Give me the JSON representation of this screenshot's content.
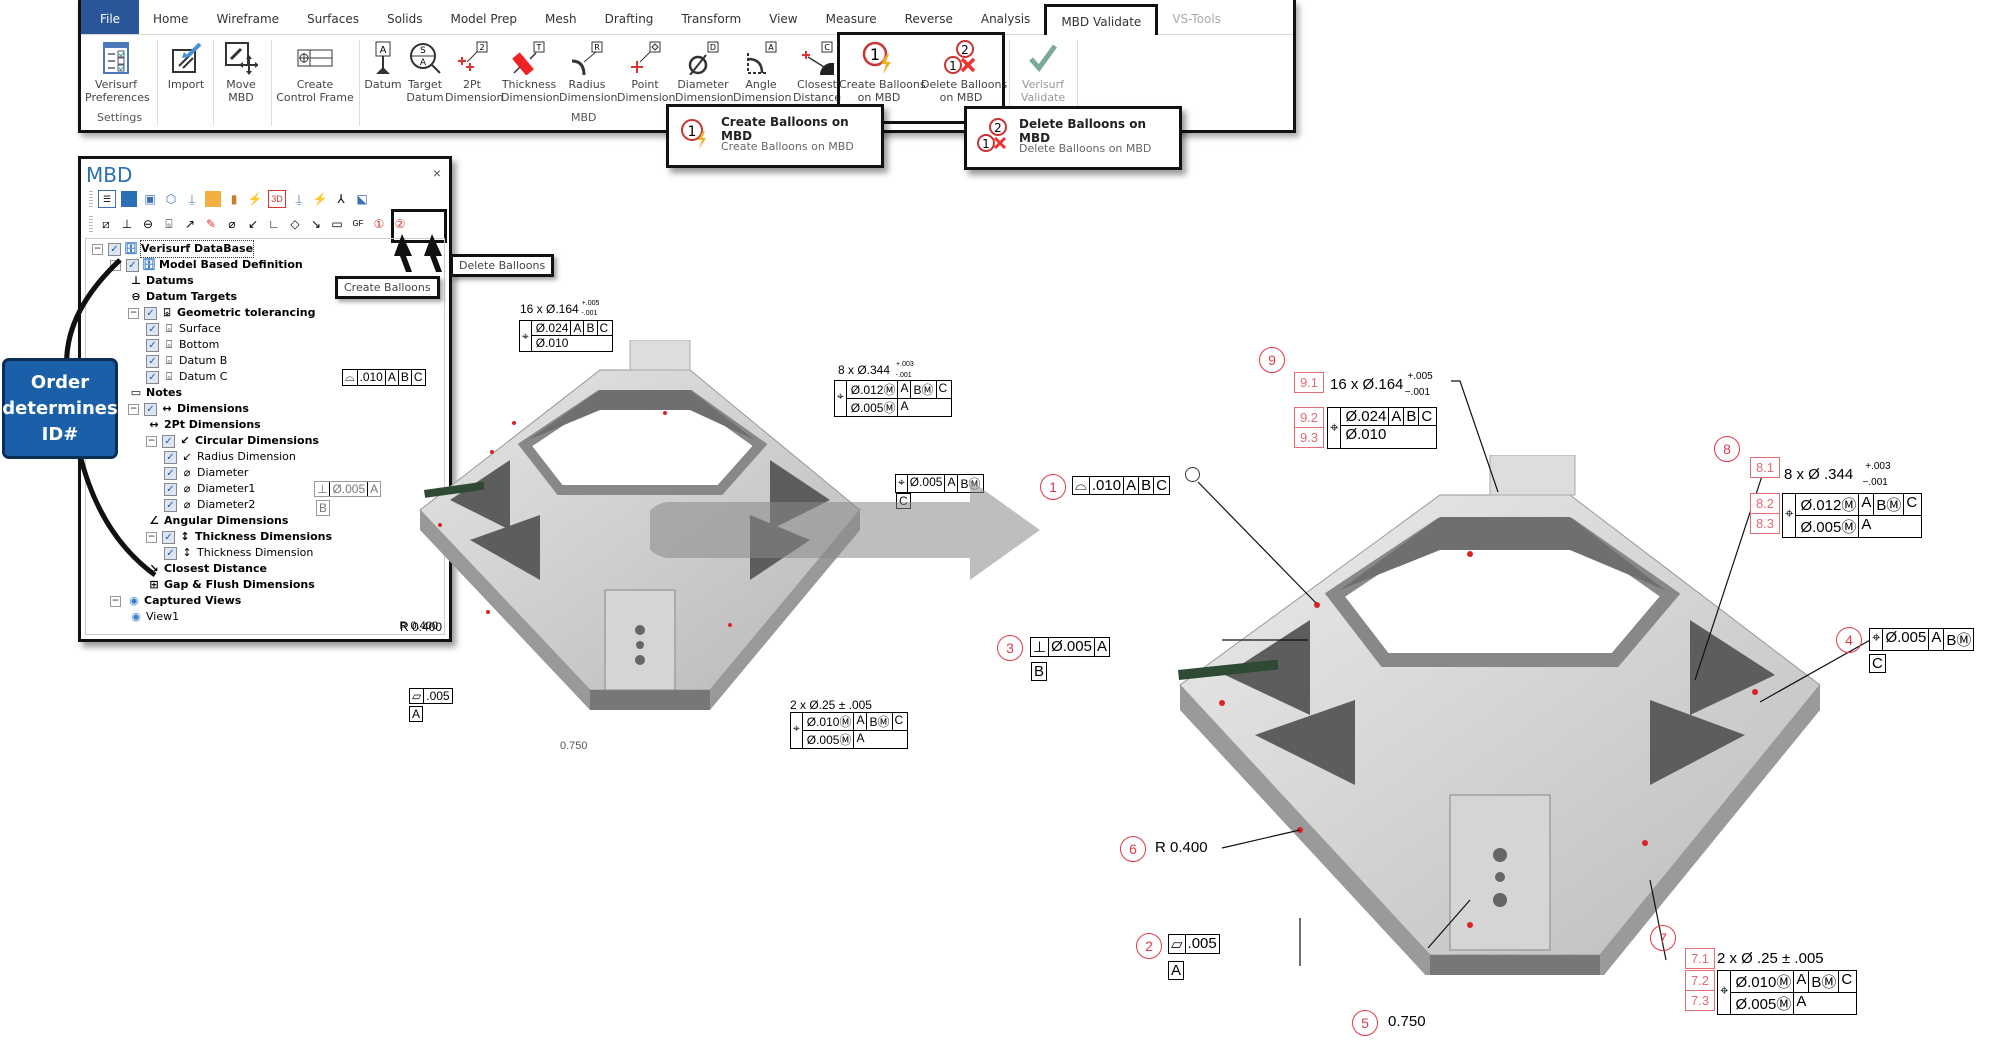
{
  "ribbon": {
    "tabs": [
      {
        "label": "File",
        "state": "file"
      },
      {
        "label": "Home"
      },
      {
        "label": "Wireframe"
      },
      {
        "label": "Surfaces"
      },
      {
        "label": "Solids"
      },
      {
        "label": "Model Prep"
      },
      {
        "label": "Mesh"
      },
      {
        "label": "Drafting"
      },
      {
        "label": "Transform"
      },
      {
        "label": "View"
      },
      {
        "label": "Measure"
      },
      {
        "label": "Reverse"
      },
      {
        "label": "Analysis"
      },
      {
        "label": "MBD Validate",
        "state": "active"
      },
      {
        "label": "VS-Tools",
        "state": "disabled"
      }
    ],
    "buttons": {
      "preferences": "Verisurf\nPreferences",
      "import": "Import",
      "move_mbd": "Move\nMBD",
      "control_frame": "Create\nControl Frame",
      "datum": "Datum",
      "target_datum": "Target\nDatum",
      "twopt": "2Pt\nDimension",
      "thickness": "Thickness\nDimension",
      "radius": "Radius\nDimension",
      "point": "Point\nDimension",
      "diameter": "Diameter\nDimension",
      "angle": "Angle\nDimension",
      "closest": "Closest\nDistance",
      "create_balloons": "Create Balloons\non MBD",
      "delete_balloons": "Delete Balloons\non MBD",
      "validate": "Verisurf\nValidate"
    },
    "groups": {
      "settings": "Settings",
      "mbd": "MBD"
    }
  },
  "tooltips": {
    "create": {
      "title": "Create Balloons on MBD",
      "desc": "Create Balloons on MBD"
    },
    "delete": {
      "title": "Delete Balloons on MBD",
      "desc": "Delete Balloons on MBD"
    },
    "create_small": "Create Balloons",
    "delete_small": "Delete Balloons"
  },
  "panel": {
    "title": "MBD",
    "close": "×",
    "tree": [
      {
        "label": "Verisurf DataBase",
        "level": 0,
        "bold": true,
        "pm": "−",
        "cb": true,
        "icon": "db"
      },
      {
        "label": "Model Based Definition",
        "level": 1,
        "bold": true,
        "pm": "−",
        "cb": true,
        "icon": "db"
      },
      {
        "label": "Datums",
        "level": 2,
        "bold": true,
        "icon": "datum"
      },
      {
        "label": "Datum Targets",
        "level": 2,
        "bold": true,
        "icon": "target"
      },
      {
        "label": "Geometric tolerancing",
        "level": 2,
        "bold": true,
        "pm": "−",
        "cb": true,
        "icon": "gt"
      },
      {
        "label": "Surface",
        "level": 3,
        "cb": true,
        "icon": "gt"
      },
      {
        "label": "Bottom",
        "level": 3,
        "cb": true,
        "icon": "gt"
      },
      {
        "label": "Datum B",
        "level": 3,
        "cb": true,
        "icon": "gt"
      },
      {
        "label": "Datum C",
        "level": 3,
        "cb": true,
        "icon": "gt"
      },
      {
        "label": "Notes",
        "level": 2,
        "bold": true,
        "icon": "note"
      },
      {
        "label": "Dimensions",
        "level": 2,
        "bold": true,
        "pm": "−",
        "cb": true,
        "icon": "dim"
      },
      {
        "label": "2Pt Dimensions",
        "level": 3,
        "bold": true,
        "icon": "dim"
      },
      {
        "label": "Circular Dimensions",
        "level": 3,
        "bold": true,
        "pm": "−",
        "cb": true,
        "icon": "rad"
      },
      {
        "label": "Radius Dimension",
        "level": 4,
        "cb": true,
        "icon": "rad"
      },
      {
        "label": "Diameter",
        "level": 4,
        "cb": true,
        "icon": "dia"
      },
      {
        "label": "Diameter1",
        "level": 4,
        "cb": true,
        "icon": "dia"
      },
      {
        "label": "Diameter2",
        "level": 4,
        "cb": true,
        "icon": "dia"
      },
      {
        "label": "Angular Dimensions",
        "level": 3,
        "bold": true,
        "icon": "ang"
      },
      {
        "label": "Thickness Dimensions",
        "level": 3,
        "bold": true,
        "pm": "−",
        "cb": true,
        "icon": "thk"
      },
      {
        "label": "Thickness Dimension",
        "level": 4,
        "cb": true,
        "icon": "thk"
      },
      {
        "label": "Closest Distance",
        "level": 3,
        "bold": true,
        "icon": "cls"
      },
      {
        "label": "Gap & Flush Dimensions",
        "level": 3,
        "bold": true,
        "icon": "gf"
      },
      {
        "label": "Captured Views",
        "level": 1,
        "bold": true,
        "pm": "−",
        "icon": "view"
      },
      {
        "label": "View1",
        "level": 2,
        "icon": "view"
      }
    ]
  },
  "callout": {
    "order": "Order\ndetermines\nID#"
  },
  "before": {
    "hole16": {
      "dim": "16 x Ø.164",
      "tol_plus": "+.005",
      "tol_minus": "-.001",
      "row1": [
        "Ø.024",
        "A",
        "B",
        "C"
      ],
      "row2": [
        "Ø.010"
      ]
    },
    "profile": [
      "⌓",
      ".010",
      "A",
      "B",
      "C"
    ],
    "perp": [
      "⊥",
      "Ø.005",
      "A"
    ],
    "perp_datum": "B",
    "hole8": {
      "dim": "8 x Ø.344",
      "tol_plus": "+.003",
      "tol_minus": "-.001",
      "row1": [
        "Ø.012Ⓜ",
        "A",
        "BⓂ",
        "C"
      ],
      "row2": [
        "Ø.005Ⓜ",
        "A"
      ]
    },
    "pos_c": [
      "⌖",
      "Ø.005",
      "A",
      "BⓂ"
    ],
    "pos_c_datum": "C",
    "radius": "R 0.400",
    "flat": [
      "▱",
      ".005"
    ],
    "flat_datum": "A",
    "hole2": {
      "dim": "2 x Ø.25 ± .005",
      "row1": [
        "Ø.010Ⓜ",
        "A",
        "BⓂ",
        "C"
      ],
      "row2": [
        "Ø.005Ⓜ",
        "A"
      ]
    },
    "thickness": "0.750"
  },
  "after": {
    "balloons": [
      "1",
      "2",
      "3",
      "4",
      "5",
      "6",
      "7",
      "8",
      "9"
    ],
    "subs": {
      "b9": [
        "9.1",
        "9.2",
        "9.3"
      ],
      "b8": [
        "8.1",
        "8.2",
        "8.3"
      ],
      "b7": [
        "7.1",
        "7.2",
        "7.3"
      ]
    },
    "hole16": {
      "dim": "16 x Ø.164",
      "tol_plus": "+.005",
      "tol_minus": "−.001",
      "row1": [
        "Ø.024",
        "A",
        "B",
        "C"
      ],
      "row2": [
        "Ø.010"
      ]
    },
    "profile": [
      "⌓",
      ".010",
      "A",
      "B",
      "C"
    ],
    "perp": [
      "⊥",
      "Ø.005",
      "A"
    ],
    "perp_datum": "B",
    "hole8": {
      "dim": "8 x Ø .344",
      "tol_plus": "+.003",
      "tol_minus": "−.001",
      "row1": [
        "Ø.012Ⓜ",
        "A",
        "BⓂ",
        "C"
      ],
      "row2": [
        "Ø.005Ⓜ",
        "A"
      ]
    },
    "pos_c": [
      "⌖",
      "Ø.005",
      "A",
      "BⓂ"
    ],
    "pos_c_datum": "C",
    "radius": "R 0.400",
    "flat": [
      "▱",
      ".005"
    ],
    "flat_datum": "A",
    "hole2": {
      "dim": "2 x Ø .25 ± .005",
      "row1": [
        "Ø.010Ⓜ",
        "A",
        "BⓂ",
        "C"
      ],
      "row2": [
        "Ø.005Ⓜ",
        "A"
      ]
    },
    "thickness": "0.750"
  },
  "colors": {
    "accent": "#2b579a",
    "balloon": "#e03a4a",
    "sub_balloon": "#e36b74",
    "callout": "#1b5fa8"
  }
}
